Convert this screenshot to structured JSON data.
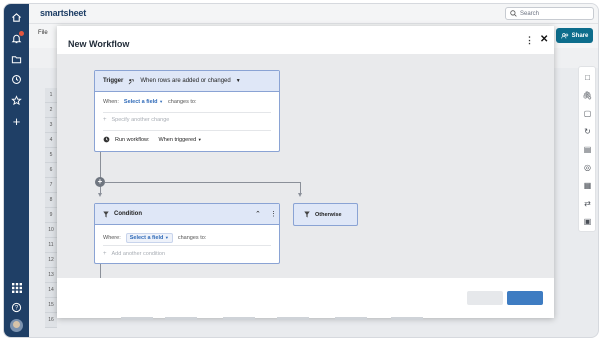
{
  "app": {
    "brand": "smartsheet",
    "search_placeholder": "Search",
    "file_menu": "File",
    "share_label": "Share"
  },
  "nav_icons": [
    "home-icon",
    "bell-icon",
    "folder-icon",
    "clock-icon",
    "star-icon",
    "plus-icon",
    "apps-grid-icon",
    "help-icon"
  ],
  "row_numbers": [
    "1",
    "2",
    "3",
    "4",
    "5",
    "6",
    "7",
    "8",
    "9",
    "10",
    "11",
    "12",
    "13",
    "14",
    "15",
    "16"
  ],
  "right_rail_icons": [
    "comment-icon",
    "attachment-icon",
    "proofs-icon",
    "activity-icon",
    "summary-icon",
    "automation-icon",
    "forms-icon",
    "update-requests-icon",
    "image-icon"
  ],
  "modal": {
    "title": "New Workflow",
    "trigger": {
      "label": "Trigger",
      "event": "When rows are added or changed",
      "when_label": "When:",
      "field_select": "Select a field",
      "changes_to": "changes to:",
      "add_change": "Specify another change",
      "run_label": "Run workflow:",
      "run_value": "When triggered"
    },
    "condition": {
      "label": "Condition",
      "where_label": "Where:",
      "field_select": "Select a field",
      "changes_to": "changes to:",
      "add_condition": "Add another condition"
    },
    "otherwise": {
      "label": "Otherwise"
    }
  },
  "colors": {
    "nav_bg": "#1f3f66",
    "share_bg": "#0d6d8c",
    "card_border": "#8aa3d4",
    "card_header": "#dfe7f7",
    "link": "#2f6ab8",
    "primary_button": "#3e7cc2"
  }
}
